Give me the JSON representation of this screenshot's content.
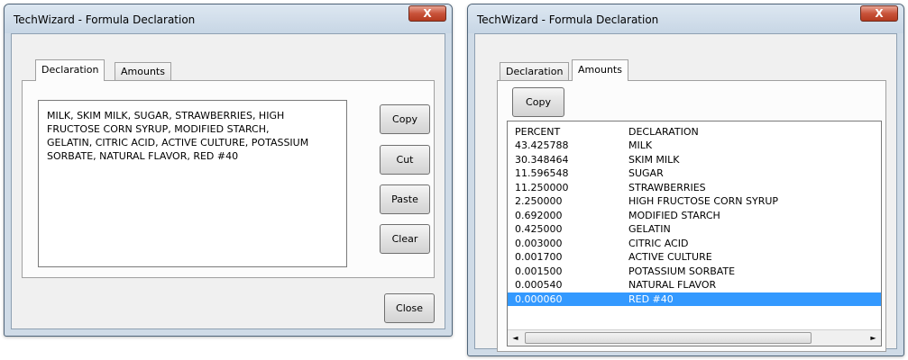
{
  "left_window": {
    "title": "TechWizard - Formula Declaration",
    "close_glyph": "X",
    "tabs": [
      "Declaration",
      "Amounts"
    ],
    "declaration_text": "MILK, SKIM MILK, SUGAR, STRAWBERRIES, HIGH\nFRUCTOSE CORN SYRUP, MODIFIED STARCH,\nGELATIN, CITRIC ACID, ACTIVE CULTURE, POTASSIUM\nSORBATE, NATURAL FLAVOR, RED #40",
    "buttons": {
      "copy": "Copy",
      "cut": "Cut",
      "paste": "Paste",
      "clear": "Clear",
      "close": "Close"
    }
  },
  "right_window": {
    "title": "TechWizard - Formula Declaration",
    "close_glyph": "X",
    "tabs": [
      "Declaration",
      "Amounts"
    ],
    "copy_button": "Copy",
    "list_header": {
      "percent": "PERCENT",
      "declaration": "DECLARATION"
    },
    "rows": [
      {
        "percent": "43.425788",
        "declaration": "MILK"
      },
      {
        "percent": "30.348464",
        "declaration": "SKIM MILK"
      },
      {
        "percent": "11.596548",
        "declaration": "SUGAR"
      },
      {
        "percent": "11.250000",
        "declaration": "STRAWBERRIES"
      },
      {
        "percent": "2.250000",
        "declaration": "HIGH FRUCTOSE CORN SYRUP"
      },
      {
        "percent": "0.692000",
        "declaration": "MODIFIED STARCH"
      },
      {
        "percent": "0.425000",
        "declaration": "GELATIN"
      },
      {
        "percent": "0.003000",
        "declaration": "CITRIC ACID"
      },
      {
        "percent": "0.001700",
        "declaration": "ACTIVE CULTURE"
      },
      {
        "percent": "0.001500",
        "declaration": "POTASSIUM SORBATE"
      },
      {
        "percent": "0.000540",
        "declaration": "NATURAL FLAVOR"
      },
      {
        "percent": "0.000060",
        "declaration": "RED #40"
      }
    ],
    "selected_row": 11,
    "scroll_left": "◄",
    "scroll_right": "►"
  },
  "colors": {
    "selection": "#3399ff",
    "close_button": "#c9533a",
    "window_frame": "#cfdbe7"
  }
}
